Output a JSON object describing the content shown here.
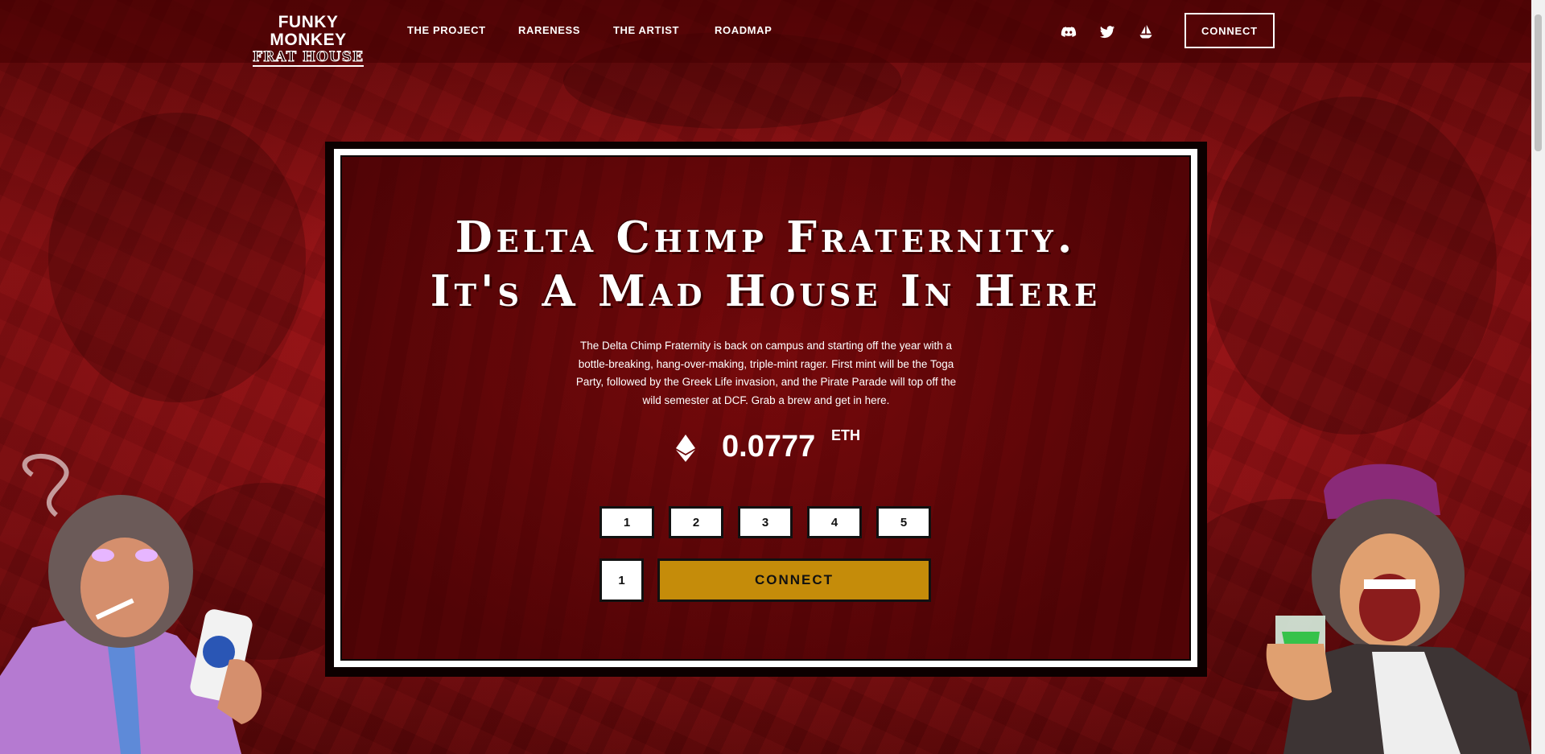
{
  "brand": {
    "line1": "FUNKY MONKEY",
    "line2": "FRAT HOUSE"
  },
  "nav": {
    "items": [
      "THE PROJECT",
      "RARENESS",
      "THE ARTIST",
      "ROADMAP"
    ]
  },
  "social": {
    "icons": [
      "discord-icon",
      "twitter-icon",
      "opensea-icon"
    ]
  },
  "header": {
    "connect_label": "CONNECT"
  },
  "hero": {
    "headline_line1": "Delta Chimp Fraternity.",
    "headline_line2": "It's A Mad House In Here",
    "description": "The Delta Chimp Fraternity is back on campus and starting off the year with a bottle-breaking, hang-over-making, triple-mint rager. First mint will be the Toga Party, followed by the Greek Life invasion, and the Pirate Parade will top off the wild semester at DCF. Grab a brew and get in here.",
    "price": "0.0777",
    "currency": "ETH"
  },
  "mint": {
    "quantity_options": [
      "1",
      "2",
      "3",
      "4",
      "5"
    ],
    "selected_amount": "1",
    "connect_label": "CONNECT"
  },
  "colors": {
    "background": "#8a0d0f",
    "accent": "#c58c0a",
    "panel": "#6d0709"
  }
}
